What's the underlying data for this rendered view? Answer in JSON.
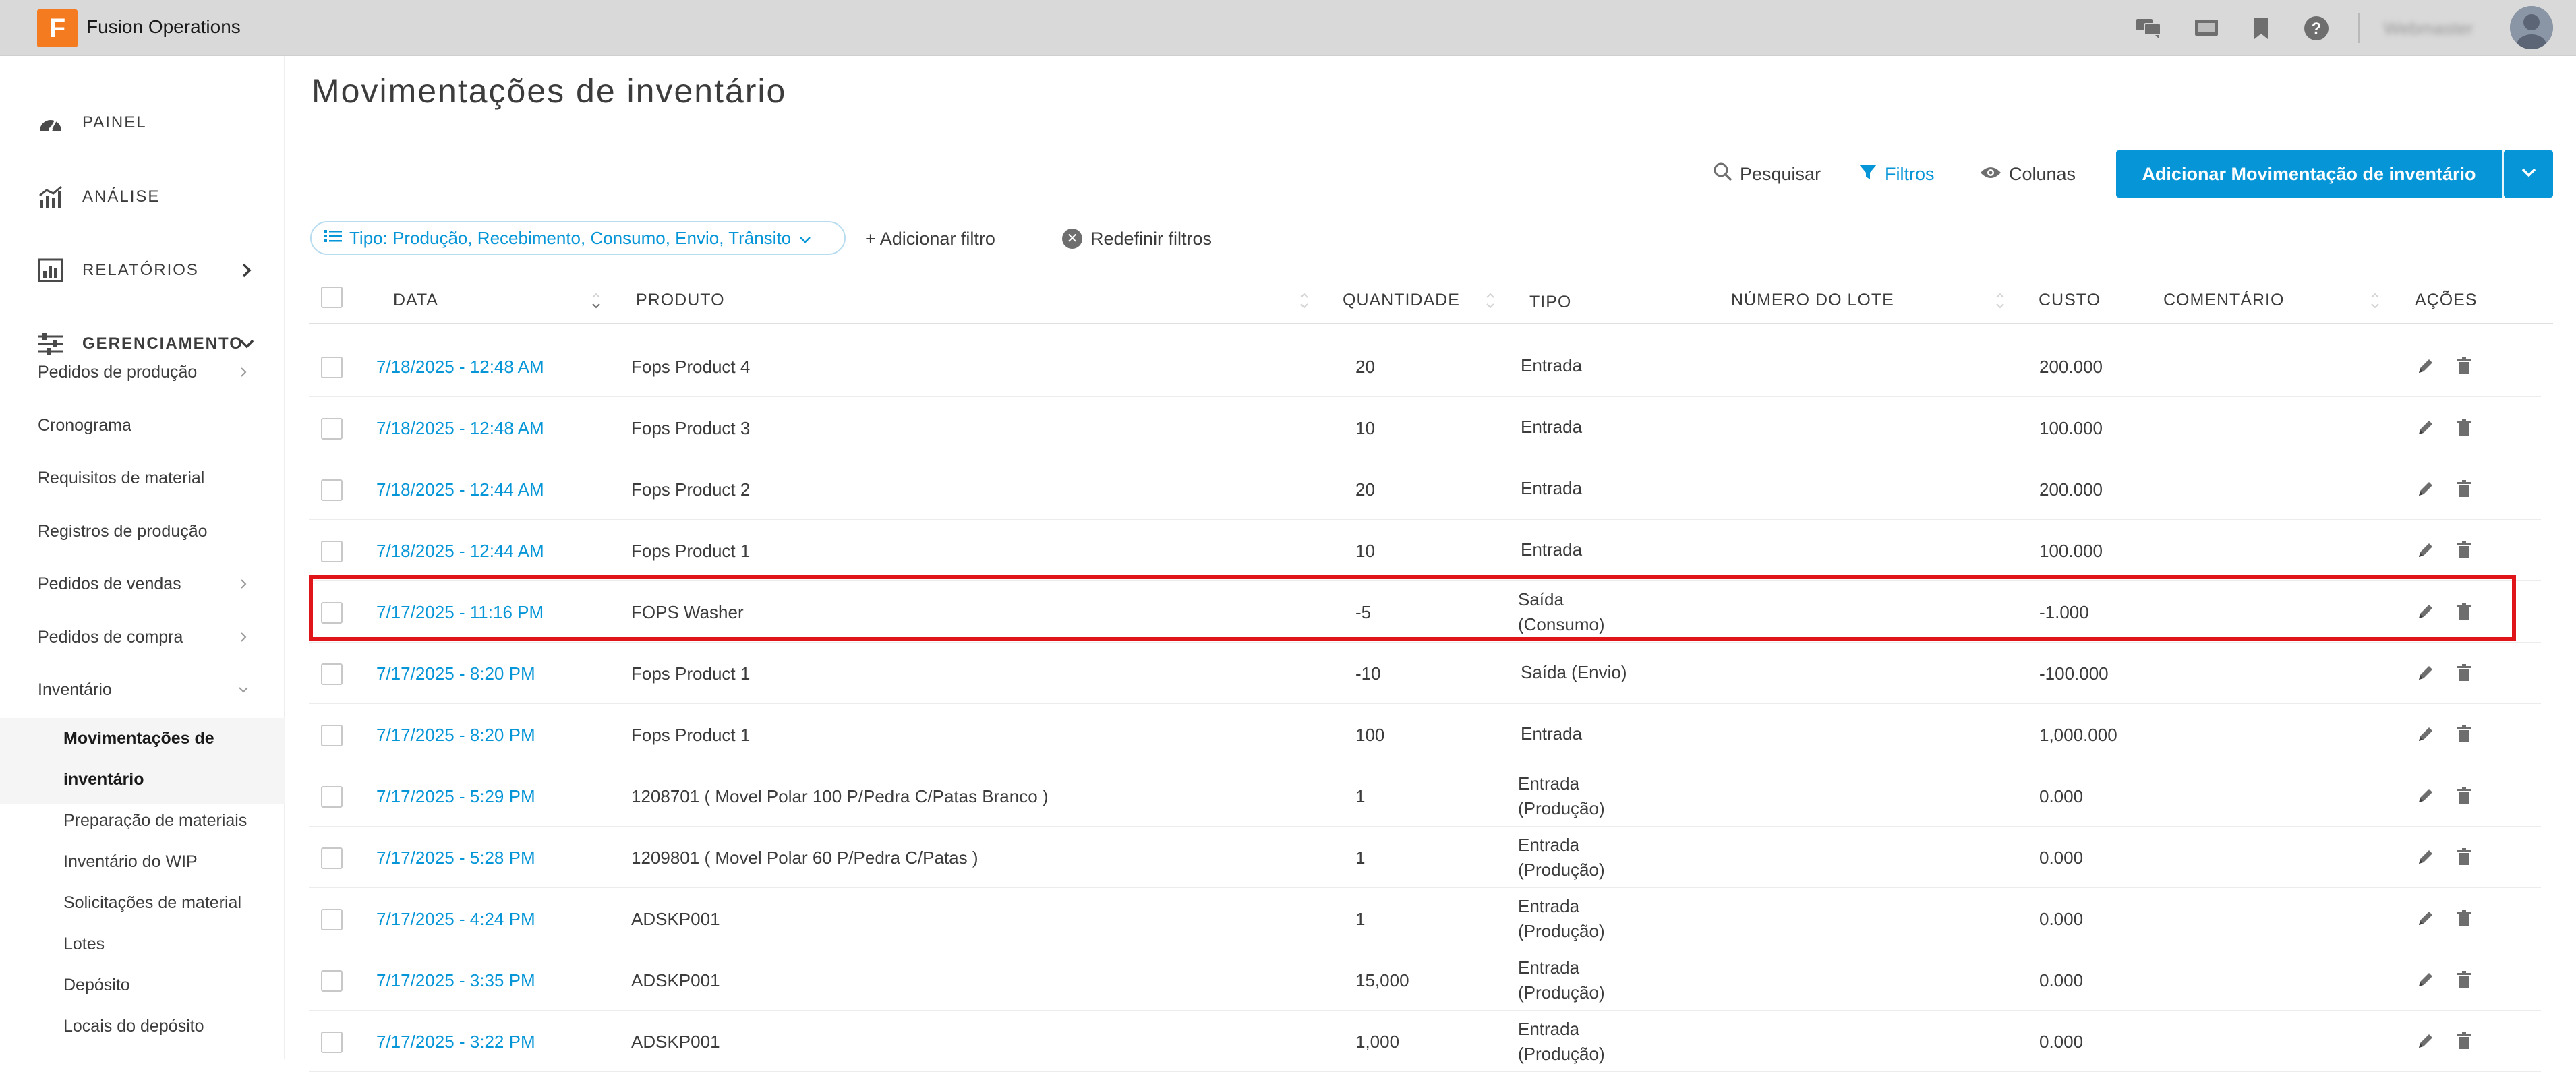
{
  "app": {
    "name": "Fusion Operations",
    "logo_letter": "F",
    "brand_color": "#f47b20",
    "accent_color": "#0696d7",
    "user_name": "Webmaster"
  },
  "header_icons": [
    "chat-icon",
    "monitor-icon",
    "bookmark-icon",
    "help-icon"
  ],
  "sidebar": {
    "sections": [
      {
        "label": "PAINEL",
        "icon": "dashboard-icon"
      },
      {
        "label": "ANÁLISE",
        "icon": "analytics-icon"
      },
      {
        "label": "RELATÓRIOS",
        "icon": "reports-icon"
      },
      {
        "label": "GERENCIAMENTO",
        "icon": "settings-sliders-icon"
      }
    ],
    "items": [
      "Pedidos de produção",
      "Cronograma",
      "Requisitos de material",
      "Registros de produção",
      "Pedidos de vendas",
      "Pedidos de compra",
      "Inventário"
    ],
    "inventory_items": [
      "Movimentações de",
      "inventário",
      "Preparação de materiais",
      "Inventário do WIP",
      "Solicitações de material",
      "Lotes",
      "Depósito",
      "Locais do depósito"
    ]
  },
  "page": {
    "title": "Movimentações de inventário"
  },
  "toolbar": {
    "search": "Pesquisar",
    "filters": "Filtros",
    "columns": "Colunas",
    "add": "Adicionar Movimentação de inventário"
  },
  "filters": {
    "chip": "Tipo: Produção, Recebimento, Consumo, Envio, Trânsito",
    "add_filter": "+ Adicionar filtro",
    "reset": "Redefinir filtros"
  },
  "table": {
    "headers": {
      "date": "DATA",
      "product": "PRODUTO",
      "quantity": "QUANTIDADE",
      "type": "TIPO",
      "lot": "NÚMERO DO LOTE",
      "cost": "CUSTO",
      "comment": "COMENTÁRIO",
      "actions": "AÇÕES"
    },
    "rows": [
      {
        "date": "7/18/2025 - 12:48 AM",
        "product": "Fops Product 4",
        "qty": "20",
        "type1": "Entrada",
        "type2": "",
        "cost": "200.000"
      },
      {
        "date": "7/18/2025 - 12:48 AM",
        "product": "Fops Product 3",
        "qty": "10",
        "type1": "Entrada",
        "type2": "",
        "cost": "100.000"
      },
      {
        "date": "7/18/2025 - 12:44 AM",
        "product": "Fops Product 2",
        "qty": "20",
        "type1": "Entrada",
        "type2": "",
        "cost": "200.000"
      },
      {
        "date": "7/18/2025 - 12:44 AM",
        "product": "Fops Product 1",
        "qty": "10",
        "type1": "Entrada",
        "type2": "",
        "cost": "100.000"
      },
      {
        "date": "7/17/2025 - 11:16 PM",
        "product": "FOPS Washer",
        "qty": "-5",
        "type1": "Saída",
        "type2": "(Consumo)",
        "cost": "-1.000"
      },
      {
        "date": "7/17/2025 - 8:20 PM",
        "product": "Fops Product 1",
        "qty": "-10",
        "type1": "Saída (Envio)",
        "type2": "",
        "cost": "-100.000"
      },
      {
        "date": "7/17/2025 - 8:20 PM",
        "product": "Fops Product 1",
        "qty": "100",
        "type1": "Entrada",
        "type2": "",
        "cost": "1,000.000"
      },
      {
        "date": "7/17/2025 - 5:29 PM",
        "product": "1208701 ( Movel Polar 100 P/Pedra C/Patas Branco )",
        "qty": "1",
        "type1": "Entrada",
        "type2": "(Produção)",
        "cost": "0.000"
      },
      {
        "date": "7/17/2025 - 5:28 PM",
        "product": "1209801 ( Movel Polar 60 P/Pedra C/Patas )",
        "qty": "1",
        "type1": "Entrada",
        "type2": "(Produção)",
        "cost": "0.000"
      },
      {
        "date": "7/17/2025 - 4:24 PM",
        "product": "ADSKP001",
        "qty": "1",
        "type1": "Entrada",
        "type2": "(Produção)",
        "cost": "0.000"
      },
      {
        "date": "7/17/2025 - 3:35 PM",
        "product": "ADSKP001",
        "qty": "15,000",
        "type1": "Entrada",
        "type2": "(Produção)",
        "cost": "0.000"
      },
      {
        "date": "7/17/2025 - 3:22 PM",
        "product": "ADSKP001",
        "qty": "1,000",
        "type1": "Entrada",
        "type2": "(Produção)",
        "cost": "0.000"
      }
    ],
    "highlighted_row": 4,
    "highlight_color": "#e0151a"
  }
}
